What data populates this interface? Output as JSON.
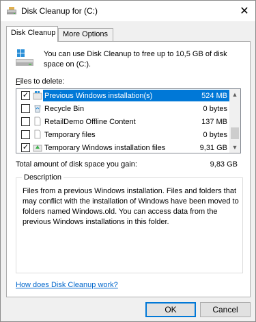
{
  "window": {
    "title": "Disk Cleanup for  (C:)",
    "close_glyph": "✕"
  },
  "tabs": [
    {
      "label": "Disk Cleanup",
      "active": true
    },
    {
      "label": "More Options",
      "active": false
    }
  ],
  "intro": {
    "text": "You can use Disk Cleanup to free up to 10,5 GB of disk space on  (C:)."
  },
  "files": {
    "label_prefix": "F",
    "label_rest": "iles to delete:",
    "items": [
      {
        "name": "Previous Windows installation(s)",
        "size": "524 MB",
        "checked": true,
        "selected": true,
        "icon": "windows-install-icon"
      },
      {
        "name": "Recycle Bin",
        "size": "0 bytes",
        "checked": false,
        "selected": false,
        "icon": "recycle-bin-icon"
      },
      {
        "name": "RetailDemo Offline Content",
        "size": "137 MB",
        "checked": false,
        "selected": false,
        "icon": "blank-file-icon"
      },
      {
        "name": "Temporary files",
        "size": "0 bytes",
        "checked": false,
        "selected": false,
        "icon": "blank-file-icon"
      },
      {
        "name": "Temporary Windows installation files",
        "size": "9,31 GB",
        "checked": true,
        "selected": false,
        "icon": "windows-install-icon"
      }
    ]
  },
  "total": {
    "label": "Total amount of disk space you gain:",
    "value": "9,83 GB"
  },
  "description": {
    "legend": "Description",
    "text": "Files from a previous Windows installation.  Files and folders that may conflict with the installation of Windows have been moved to folders named Windows.old.  You can access data from the previous Windows installations in this folder."
  },
  "help_link": "How does Disk Cleanup work?",
  "buttons": {
    "ok": "OK",
    "cancel": "Cancel"
  },
  "colors": {
    "accent": "#0078d7",
    "link": "#0066cc"
  }
}
